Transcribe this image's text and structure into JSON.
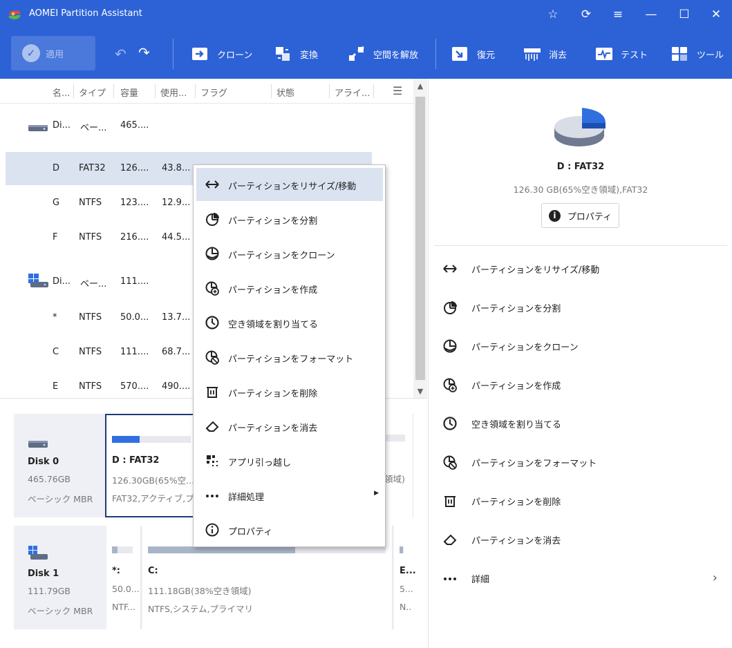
{
  "window": {
    "title": "AOMEI Partition Assistant",
    "controls": [
      "☆",
      "⟳",
      "≡",
      "—",
      "☐",
      "✕"
    ]
  },
  "toolbar": {
    "apply": "適用",
    "items": [
      {
        "label": "クローン",
        "icon": "clone-icon"
      },
      {
        "label": "変換",
        "icon": "convert-icon"
      },
      {
        "label": "空間を解放",
        "icon": "free-space-icon"
      },
      {
        "label": "復元",
        "icon": "recovery-icon"
      },
      {
        "label": "消去",
        "icon": "wipe-icon"
      },
      {
        "label": "テスト",
        "icon": "test-icon"
      },
      {
        "label": "ツール",
        "icon": "tools-icon"
      }
    ]
  },
  "table": {
    "headers": [
      "名...",
      "タイプ",
      "容量",
      "使用...",
      "フラグ",
      "状態",
      "アライ..."
    ],
    "rows": [
      {
        "kind": "disk",
        "name": "Di...",
        "type": "ベー...",
        "capacity": "465....",
        "used": ""
      },
      {
        "kind": "part",
        "name": "D",
        "type": "FAT32",
        "capacity": "126....",
        "used": "43.8...",
        "selected": true
      },
      {
        "kind": "part",
        "name": "G",
        "type": "NTFS",
        "capacity": "123....",
        "used": "12.9..."
      },
      {
        "kind": "part",
        "name": "F",
        "type": "NTFS",
        "capacity": "216....",
        "used": "44.5..."
      },
      {
        "kind": "disk2",
        "name": "Di...",
        "type": "ベー...",
        "capacity": "111....",
        "used": ""
      },
      {
        "kind": "part",
        "name": "*",
        "type": "NTFS",
        "capacity": "50.0...",
        "used": "13.7..."
      },
      {
        "kind": "part",
        "name": "C",
        "type": "NTFS",
        "capacity": "111....",
        "used": "68.7..."
      },
      {
        "kind": "part",
        "name": "E",
        "type": "NTFS",
        "capacity": "570....",
        "used": "490...."
      }
    ]
  },
  "diskmap": {
    "disk0": {
      "name": "Disk 0",
      "size": "465.76GB",
      "type": "ベーシック MBR",
      "partitions": [
        {
          "name": "D : FAT32",
          "line1": "126.30GB(65%空...",
          "line2": "FAT32,アクティブ,プ...",
          "fill": 0.35
        },
        {
          "name": "",
          "line1": "領域)",
          "line2": "",
          "fill": 0.2
        }
      ]
    },
    "disk1": {
      "name": "Disk 1",
      "size": "111.79GB",
      "type": "ベーシック MBR",
      "partitions": [
        {
          "name": "*:",
          "line1": "50.0...",
          "line2": "NTF...",
          "fill": 0.27
        },
        {
          "name": "C:",
          "line1": "111.18GB(38%空き領域)",
          "line2": "NTFS,システム,プライマリ",
          "fill": 0.62
        },
        {
          "name": "E...",
          "line1": "5...",
          "line2": "N..",
          "fill": 0.86
        }
      ]
    }
  },
  "context_menu": {
    "items": [
      {
        "label": "パーティションをリサイズ/移動",
        "icon": "resize-icon",
        "highlighted": true
      },
      {
        "label": "パーティションを分割",
        "icon": "split-icon"
      },
      {
        "label": "パーティションをクローン",
        "icon": "clone-partition-icon"
      },
      {
        "label": "パーティションを作成",
        "icon": "create-partition-icon"
      },
      {
        "label": "空き領域を割り当てる",
        "icon": "allocate-icon"
      },
      {
        "label": "パーティションをフォーマット",
        "icon": "format-icon"
      },
      {
        "label": "パーティションを削除",
        "icon": "trash-icon"
      },
      {
        "label": "パーティションを消去",
        "icon": "eraser-icon"
      },
      {
        "label": "アプリ引っ越し",
        "icon": "app-move-icon"
      },
      {
        "label": "詳細処理",
        "icon": "more-icon",
        "submenu": true
      },
      {
        "label": "プロパティ",
        "icon": "info-icon"
      }
    ],
    "submenu_arrow": "▶"
  },
  "right_panel": {
    "title": "D : FAT32",
    "subtitle": "126.30 GB(65%空き領域),FAT32",
    "properties_button": "プロパティ",
    "items": [
      {
        "label": "パーティションをリサイズ/移動",
        "icon": "resize-icon"
      },
      {
        "label": "パーティションを分割",
        "icon": "split-icon"
      },
      {
        "label": "パーティションをクローン",
        "icon": "clone-partition-icon"
      },
      {
        "label": "パーティションを作成",
        "icon": "create-partition-icon"
      },
      {
        "label": "空き領域を割り当てる",
        "icon": "allocate-icon"
      },
      {
        "label": "パーティションをフォーマット",
        "icon": "format-icon"
      },
      {
        "label": "パーティションを削除",
        "icon": "trash-icon"
      },
      {
        "label": "パーティションを消去",
        "icon": "eraser-icon"
      },
      {
        "label": "詳細",
        "icon": "more-icon",
        "chevron": "›"
      }
    ]
  },
  "colors": {
    "accent": "#2d62d6",
    "selection": "#dbe3f1",
    "usage_bar_partition": "#2f6fe0",
    "usage_bar_other": "#a8b4c8",
    "selected_border": "#1f3b78"
  }
}
